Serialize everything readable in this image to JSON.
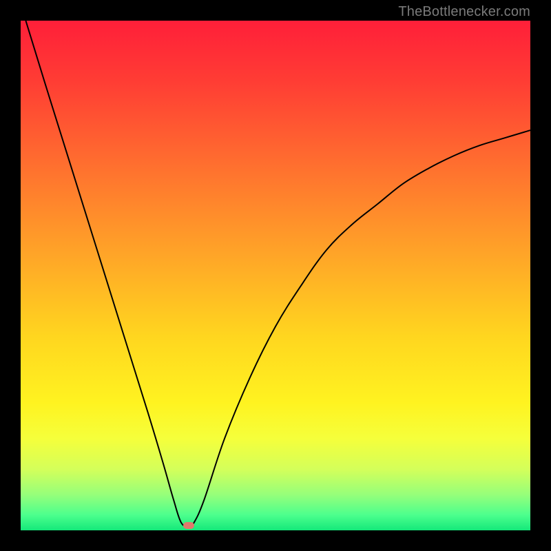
{
  "watermark": {
    "text": "TheBottlenecker.com"
  },
  "chart_data": {
    "type": "line",
    "title": "",
    "xlabel": "",
    "ylabel": "",
    "xlim": [
      0,
      100
    ],
    "ylim": [
      0,
      100
    ],
    "background_gradient": {
      "stops": [
        {
          "offset": 0.0,
          "color": "#ff1f39"
        },
        {
          "offset": 0.12,
          "color": "#ff3d34"
        },
        {
          "offset": 0.28,
          "color": "#ff6e2f"
        },
        {
          "offset": 0.45,
          "color": "#ffa228"
        },
        {
          "offset": 0.62,
          "color": "#ffd61f"
        },
        {
          "offset": 0.75,
          "color": "#fff320"
        },
        {
          "offset": 0.82,
          "color": "#f5ff3b"
        },
        {
          "offset": 0.88,
          "color": "#d4ff5a"
        },
        {
          "offset": 0.93,
          "color": "#96ff7a"
        },
        {
          "offset": 0.97,
          "color": "#4cff8d"
        },
        {
          "offset": 1.0,
          "color": "#14e87a"
        }
      ]
    },
    "series": [
      {
        "name": "bottleneck-curve",
        "color": "#000000",
        "stroke_width": 2,
        "x": [
          1,
          5,
          10,
          15,
          20,
          25,
          28,
          30,
          31.5,
          33,
          34,
          36,
          40,
          45,
          50,
          55,
          60,
          65,
          70,
          75,
          80,
          85,
          90,
          95,
          100
        ],
        "y": [
          100,
          87,
          71,
          55,
          39,
          23,
          13,
          6,
          1.5,
          0.8,
          1.5,
          6,
          18,
          30,
          40,
          48,
          55,
          60,
          64,
          68,
          71,
          73.5,
          75.5,
          77,
          78.5
        ]
      }
    ],
    "annotations": [
      {
        "name": "min-marker",
        "x": 33,
        "y": 0.9,
        "color": "#e0796c"
      }
    ]
  }
}
